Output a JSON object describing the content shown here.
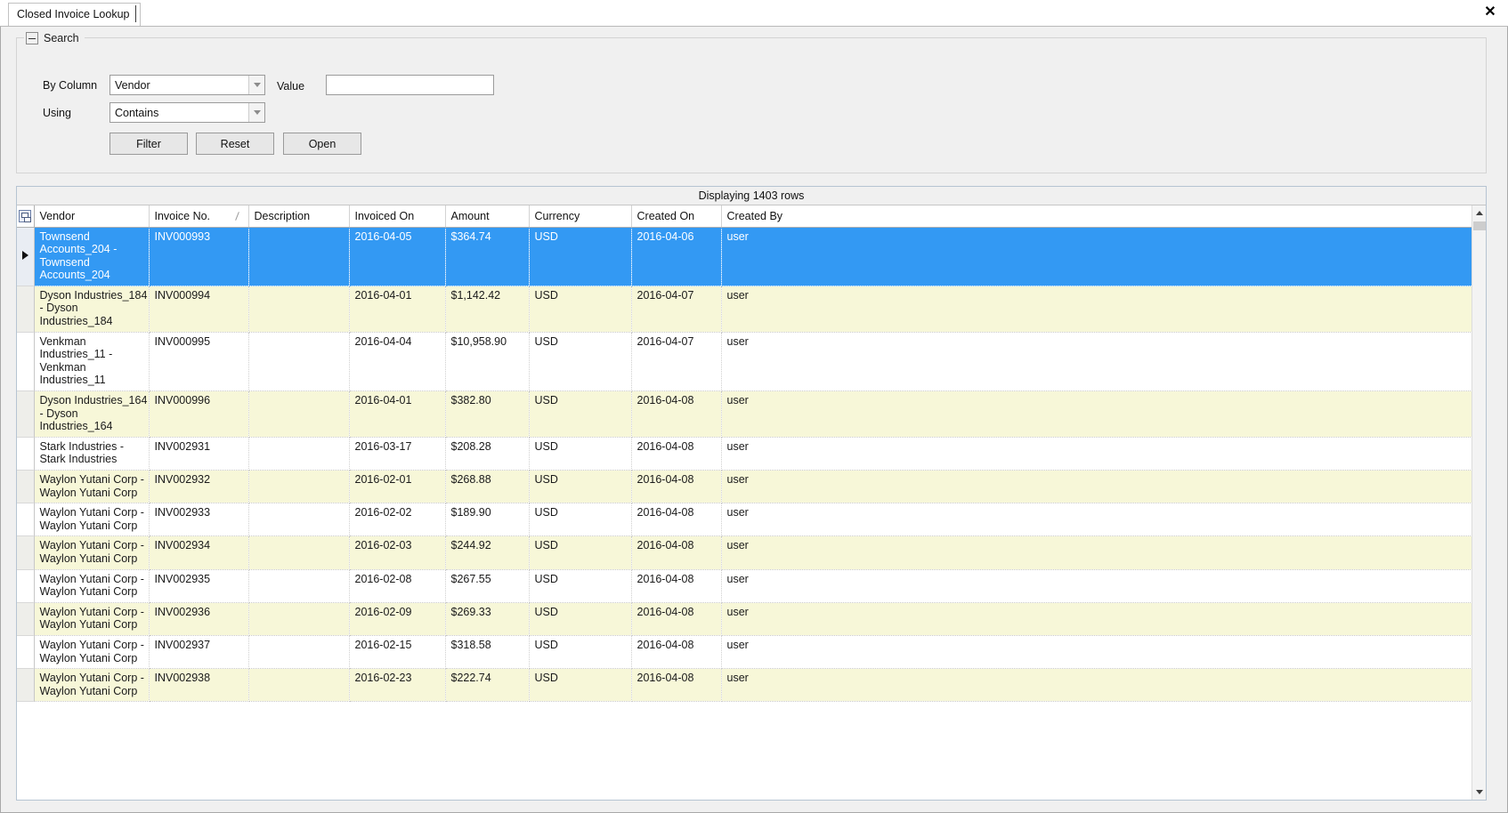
{
  "window": {
    "tab_label": "Closed Invoice Lookup",
    "close_label": "✕"
  },
  "search": {
    "group_title": "Search",
    "by_column_label": "By Column",
    "by_column_value": "Vendor",
    "using_label": "Using",
    "using_value": "Contains",
    "value_label": "Value",
    "value_text": "",
    "value_placeholder": "",
    "filter_label": "Filter",
    "reset_label": "Reset",
    "open_label": "Open"
  },
  "grid": {
    "caption": "Displaying 1403 rows",
    "sort_column": "Invoice No.",
    "sort_direction": "ascending",
    "selected_row_index": 0,
    "columns": [
      {
        "key": "vendor",
        "label": "Vendor"
      },
      {
        "key": "invoice_no",
        "label": "Invoice No."
      },
      {
        "key": "description",
        "label": "Description"
      },
      {
        "key": "invoiced_on",
        "label": "Invoiced On"
      },
      {
        "key": "amount",
        "label": "Amount"
      },
      {
        "key": "currency",
        "label": "Currency"
      },
      {
        "key": "created_on",
        "label": "Created On"
      },
      {
        "key": "created_by",
        "label": "Created By"
      }
    ],
    "rows": [
      {
        "vendor": "Townsend Accounts_204 - Townsend Accounts_204",
        "invoice_no": "INV000993",
        "description": "",
        "invoiced_on": "2016-04-05",
        "amount": "$364.74",
        "currency": "USD",
        "created_on": "2016-04-06",
        "created_by": "user"
      },
      {
        "vendor": "Dyson Industries_184 - Dyson Industries_184",
        "invoice_no": "INV000994",
        "description": "",
        "invoiced_on": "2016-04-01",
        "amount": "$1,142.42",
        "currency": "USD",
        "created_on": "2016-04-07",
        "created_by": "user"
      },
      {
        "vendor": "Venkman Industries_11 - Venkman Industries_11",
        "invoice_no": "INV000995",
        "description": "",
        "invoiced_on": "2016-04-04",
        "amount": "$10,958.90",
        "currency": "USD",
        "created_on": "2016-04-07",
        "created_by": "user"
      },
      {
        "vendor": "Dyson Industries_164 - Dyson Industries_164",
        "invoice_no": "INV000996",
        "description": "",
        "invoiced_on": "2016-04-01",
        "amount": "$382.80",
        "currency": "USD",
        "created_on": "2016-04-08",
        "created_by": "user"
      },
      {
        "vendor": "Stark Industries - Stark Industries",
        "invoice_no": "INV002931",
        "description": "",
        "invoiced_on": "2016-03-17",
        "amount": "$208.28",
        "currency": "USD",
        "created_on": "2016-04-08",
        "created_by": "user"
      },
      {
        "vendor": "Waylon Yutani Corp - Waylon Yutani Corp",
        "invoice_no": "INV002932",
        "description": "",
        "invoiced_on": "2016-02-01",
        "amount": "$268.88",
        "currency": "USD",
        "created_on": "2016-04-08",
        "created_by": "user"
      },
      {
        "vendor": "Waylon Yutani Corp - Waylon Yutani Corp",
        "invoice_no": "INV002933",
        "description": "",
        "invoiced_on": "2016-02-02",
        "amount": "$189.90",
        "currency": "USD",
        "created_on": "2016-04-08",
        "created_by": "user"
      },
      {
        "vendor": "Waylon Yutani Corp - Waylon Yutani Corp",
        "invoice_no": "INV002934",
        "description": "",
        "invoiced_on": "2016-02-03",
        "amount": "$244.92",
        "currency": "USD",
        "created_on": "2016-04-08",
        "created_by": "user"
      },
      {
        "vendor": "Waylon Yutani Corp - Waylon Yutani Corp",
        "invoice_no": "INV002935",
        "description": "",
        "invoiced_on": "2016-02-08",
        "amount": "$267.55",
        "currency": "USD",
        "created_on": "2016-04-08",
        "created_by": "user"
      },
      {
        "vendor": "Waylon Yutani Corp - Waylon Yutani Corp",
        "invoice_no": "INV002936",
        "description": "",
        "invoiced_on": "2016-02-09",
        "amount": "$269.33",
        "currency": "USD",
        "created_on": "2016-04-08",
        "created_by": "user"
      },
      {
        "vendor": "Waylon Yutani Corp - Waylon Yutani Corp",
        "invoice_no": "INV002937",
        "description": "",
        "invoiced_on": "2016-02-15",
        "amount": "$318.58",
        "currency": "USD",
        "created_on": "2016-04-08",
        "created_by": "user"
      },
      {
        "vendor": "Waylon Yutani Corp - Waylon Yutani Corp",
        "invoice_no": "INV002938",
        "description": "",
        "invoiced_on": "2016-02-23",
        "amount": "$222.74",
        "currency": "USD",
        "created_on": "2016-04-08",
        "created_by": "user"
      }
    ]
  },
  "colors": {
    "selection": "#3399f3",
    "alt_row": "#f7f7d8",
    "chrome": "#f0f0f0"
  }
}
